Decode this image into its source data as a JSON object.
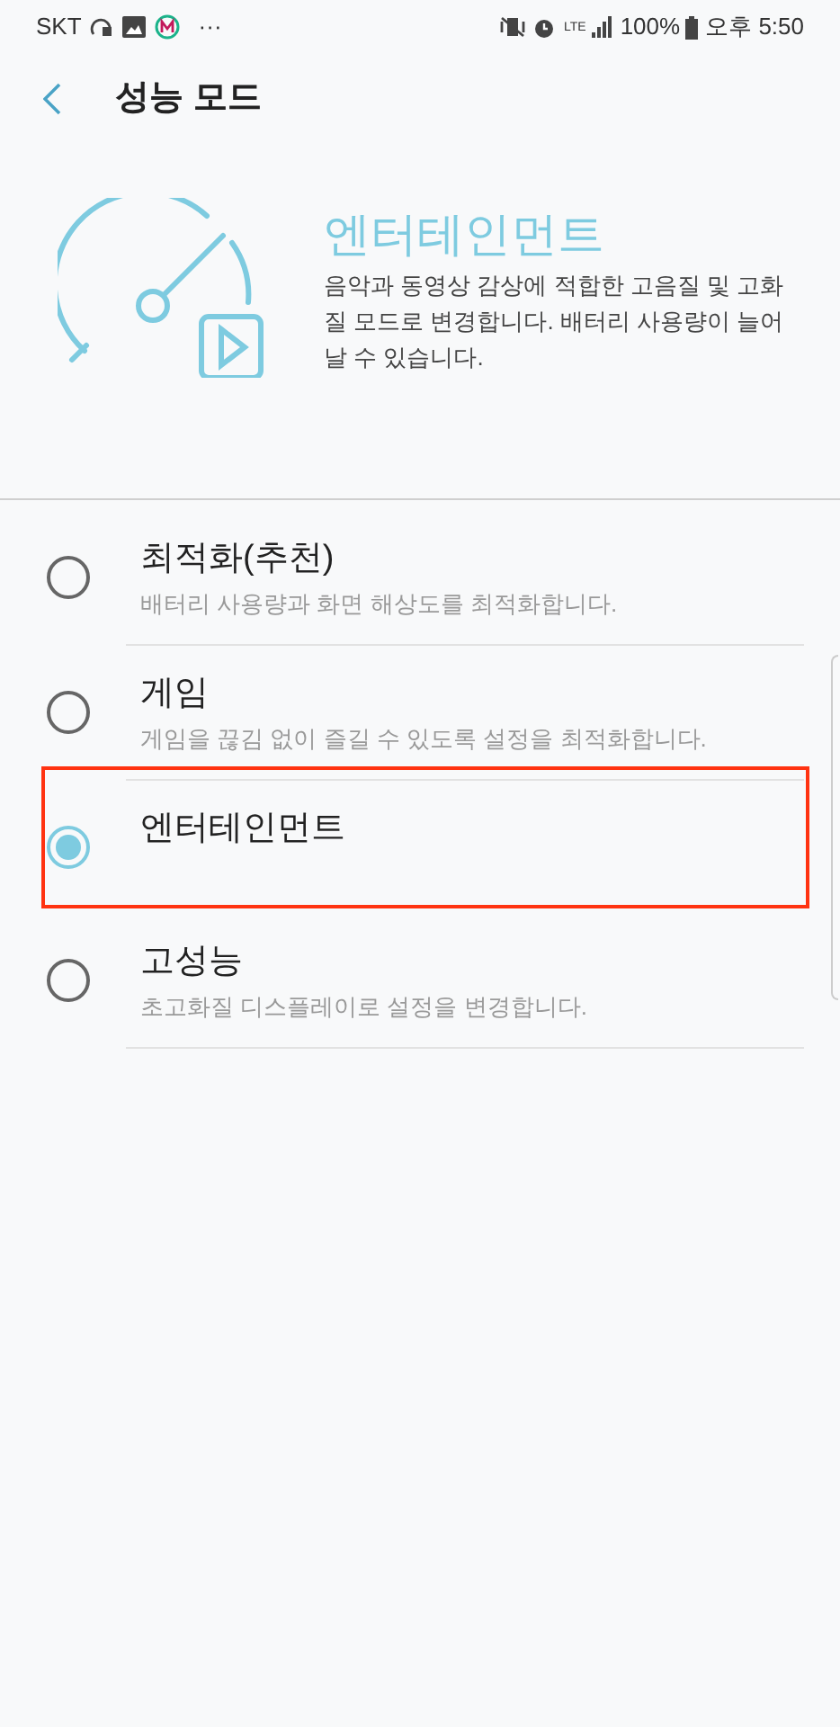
{
  "status_bar": {
    "carrier": "SKT",
    "more": "···",
    "network": "LTE",
    "battery": "100%",
    "time": "오후 5:50"
  },
  "header": {
    "title": "성능 모드"
  },
  "hero": {
    "title": "엔터테인먼트",
    "description": "음악과 동영상 감상에 적합한 고음질 및 고화질 모드로 변경합니다. 배터리 사용량이 늘어날 수 있습니다."
  },
  "options": [
    {
      "label": "최적화(추천)",
      "description": "배터리 사용량과 화면 해상도를 최적화합니다.",
      "selected": false,
      "highlighted": false
    },
    {
      "label": "게임",
      "description": "게임을 끊김 없이 즐길 수 있도록 설정을 최적화합니다.",
      "selected": false,
      "highlighted": false
    },
    {
      "label": "엔터테인먼트",
      "selected": true,
      "highlighted": true
    },
    {
      "label": "고성능",
      "description": "초고화질 디스플레이로 설정을 변경합니다.",
      "selected": false,
      "highlighted": false
    }
  ]
}
